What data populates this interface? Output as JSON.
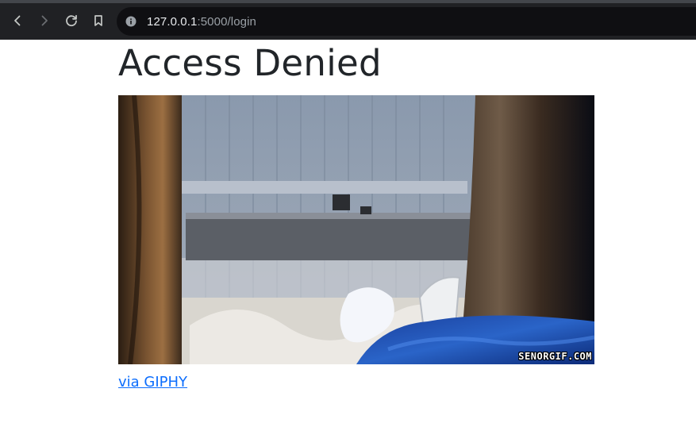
{
  "browser": {
    "url_host": "127.0.0.1",
    "url_rest": ":5000/login",
    "icons": {
      "back": "back-arrow-icon",
      "forward": "forward-arrow-icon",
      "reload": "reload-icon",
      "bookmark": "bookmark-icon",
      "site_info": "info-icon"
    }
  },
  "page": {
    "title": "Access Denied",
    "gif_watermark": "SENORGIF.COM",
    "link_text": "via GIPHY"
  },
  "colors": {
    "toolbar": "#202124",
    "omnibox": "#0f0f12",
    "text": "#212529",
    "link": "#0d6efd"
  }
}
